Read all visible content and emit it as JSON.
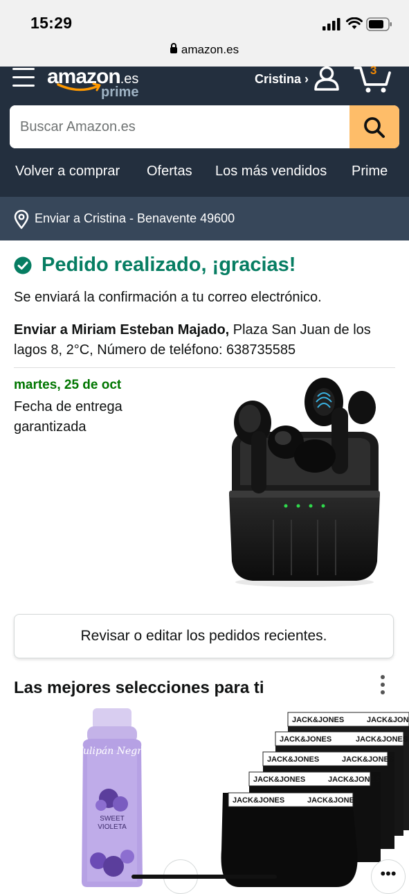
{
  "status_bar": {
    "time": "15:29",
    "url": "amazon.es"
  },
  "header": {
    "logo_text": "amazon",
    "logo_suffix": ".es",
    "logo_prime": "prime",
    "account_label": "Cristina ›",
    "cart_count": "3",
    "accent_color": "#febd69",
    "header_color": "#232f3e"
  },
  "search": {
    "placeholder": "Buscar Amazon.es",
    "value": ""
  },
  "nav": {
    "items": [
      {
        "label": "Volver a comprar"
      },
      {
        "label": "Ofertas"
      },
      {
        "label": "Los más vendidos"
      },
      {
        "label": "Prime"
      }
    ]
  },
  "deliver_to": {
    "text": "Enviar a Cristina - Benavente 49600"
  },
  "confirmation": {
    "title": "Pedido realizado, ¡gracias!",
    "subtitle": "Se enviará la confirmación a tu correo electrónico.",
    "ship_to_label": "Enviar a Miriam Esteban Majado,",
    "ship_to_address": " Plaza San Juan de los lagos 8, 2°C, Número de teléfono: 638735585",
    "delivery_date": "martes, 25 de oct",
    "delivery_note": "Fecha de entrega garantizada",
    "success_color": "#067d62"
  },
  "review_button": {
    "label": "Revisar o editar los pedidos recientes."
  },
  "recommendations": {
    "title": "Las mejores selecciones para ti",
    "product_1": {
      "brand": "Tulipán Negro",
      "name_line1": "SWEET",
      "name_line2": "VIOLETA"
    },
    "product_2": {
      "brand": "JACK&JONES"
    }
  }
}
